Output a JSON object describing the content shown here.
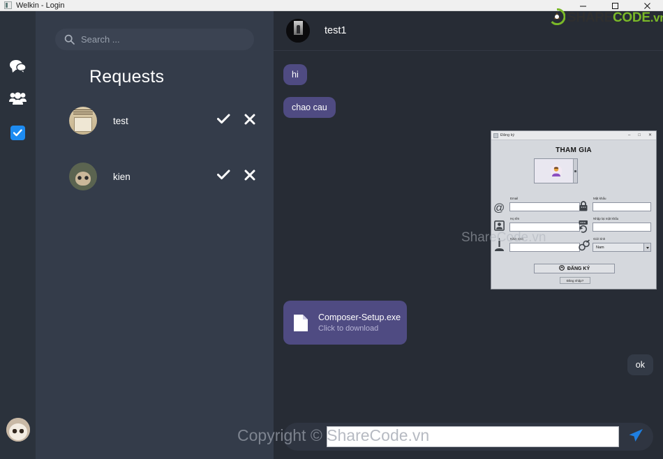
{
  "window": {
    "title": "Welkin - Login",
    "icon": "app-icon",
    "controls": {
      "minimize": "minimize",
      "maximize": "maximize",
      "close": "close"
    }
  },
  "rail": {
    "items": [
      {
        "name": "chats",
        "icon": "chat-bubbles-icon",
        "active": false
      },
      {
        "name": "contacts",
        "icon": "people-group-icon",
        "active": false
      },
      {
        "name": "requests",
        "icon": "checkbox-checked-icon",
        "active": true
      }
    ],
    "profile_avatar": "cat-avatar",
    "accent_color": "#1d8bf1"
  },
  "requests_panel": {
    "search": {
      "placeholder": "Search ...",
      "value": "",
      "icon": "search-icon"
    },
    "title": "Requests",
    "items": [
      {
        "name": "test",
        "avatar": "newspaper-avatar",
        "accept_icon": "check-icon",
        "accept_label": "Accept",
        "reject_icon": "cross-icon",
        "reject_label": "Reject"
      },
      {
        "name": "kien",
        "avatar": "cat-avatar",
        "accept_icon": "check-icon",
        "accept_label": "Accept",
        "reject_icon": "cross-icon",
        "reject_label": "Reject"
      }
    ]
  },
  "chat": {
    "header": {
      "name": "test1",
      "avatar": "dark-photo-avatar"
    },
    "messages": [
      {
        "text": "hi",
        "side": "in"
      },
      {
        "text": "chao cau",
        "side": "in"
      },
      {
        "text": "ok",
        "side": "out"
      }
    ],
    "file_attachment": {
      "filename": "Composer-Setup.exe",
      "hint": "Click to download",
      "icon": "file-icon"
    },
    "shared_image": {
      "window_title": "Đăng ký",
      "window_icon": "app-icon",
      "controls": {
        "minimize": "–",
        "maximize": "□",
        "close": "✕"
      },
      "heading": "THAM GIA",
      "photo_placeholder": "avatar-person-icon",
      "fields": [
        {
          "label": "Email",
          "icon": "at-icon",
          "value": ""
        },
        {
          "label": "Mật khẩu",
          "icon": "lock-icon",
          "value": ""
        },
        {
          "label": "Họ tên",
          "icon": "user-card-icon",
          "value": ""
        },
        {
          "label": "Nhập lại mật khẩu",
          "icon": "password-dots-icon",
          "value": ""
        },
        {
          "label": "Năm sinh",
          "icon": "candle-icon",
          "value": ""
        },
        {
          "label": "Giới tính",
          "icon": "gender-icon",
          "value": "Nam"
        }
      ],
      "submit_label": "ĐĂNG KÝ",
      "login_link": "Đăng nhập?"
    },
    "composer": {
      "value": "",
      "placeholder": "",
      "send_icon": "send-paper-plane-icon"
    }
  },
  "watermarks": {
    "bottom": "Copyright © ShareCode.vn",
    "middle": "ShareCode.vn",
    "logo": {
      "share": "SHARE",
      "code": "CODE",
      "vn": ".vn",
      "icon": "sharecode-logo-icon"
    }
  },
  "colors": {
    "rail_bg": "#2b323c",
    "list_bg": "#343c4a",
    "chat_bg": "#272c35",
    "bubble_in": "#4f4b82",
    "bubble_out": "#333a46",
    "accent_blue": "#1d8bf1",
    "logo_green": "#7ab828"
  }
}
